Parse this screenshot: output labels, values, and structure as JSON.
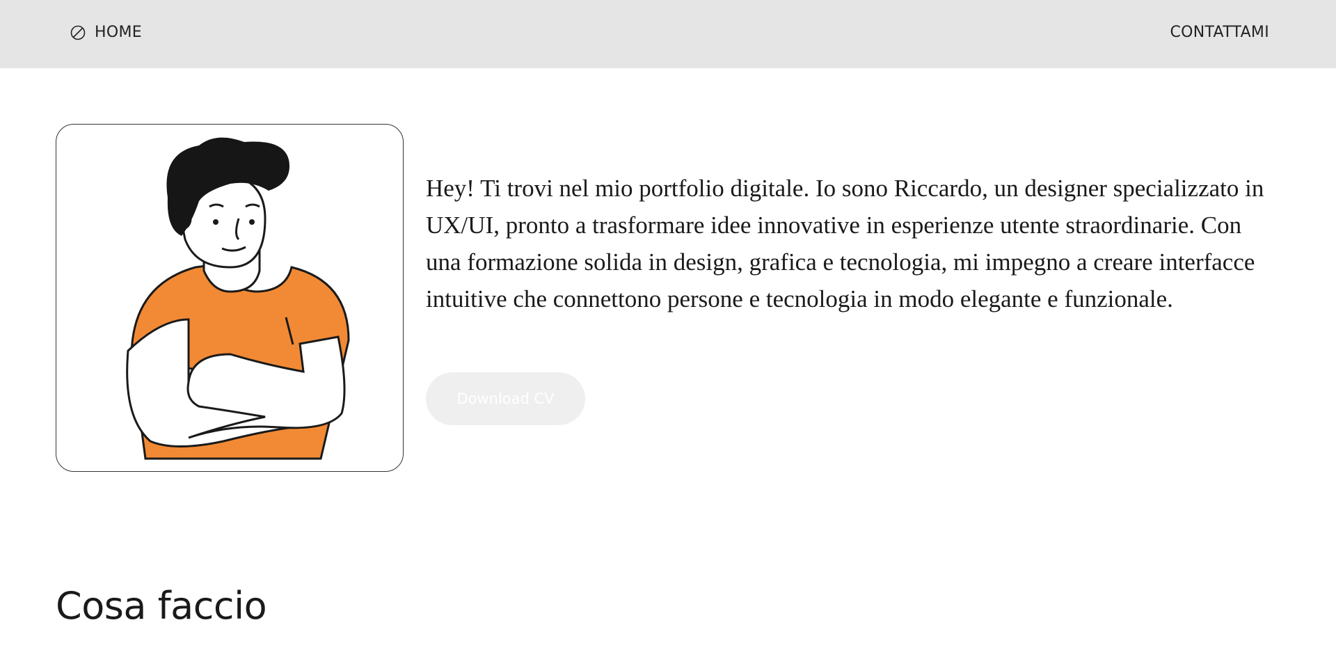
{
  "nav": {
    "home_label": "HOME",
    "home_icon": "compass-icon",
    "contact_label": "CONTATTAMI"
  },
  "hero": {
    "avatar": "cartoon-man-crossed-arms",
    "intro": "Hey! Ti trovi nel mio portfolio digitale. Io sono Riccardo, un designer specializzato in UX/UI, pronto a trasformare idee innovative in esperienze utente straordinarie. Con una formazione solida in design, grafica e tecnologia, mi impegno a creare interfacce intuitive che connettono persone e tecnologia in modo elegante e funzionale.",
    "download_label": "Download CV"
  },
  "sections": {
    "what_i_do_title": "Cosa faccio"
  },
  "colors": {
    "topbar_bg": "#e5e5e5",
    "shirt": "#f28a35",
    "button_bg": "#efefef"
  }
}
